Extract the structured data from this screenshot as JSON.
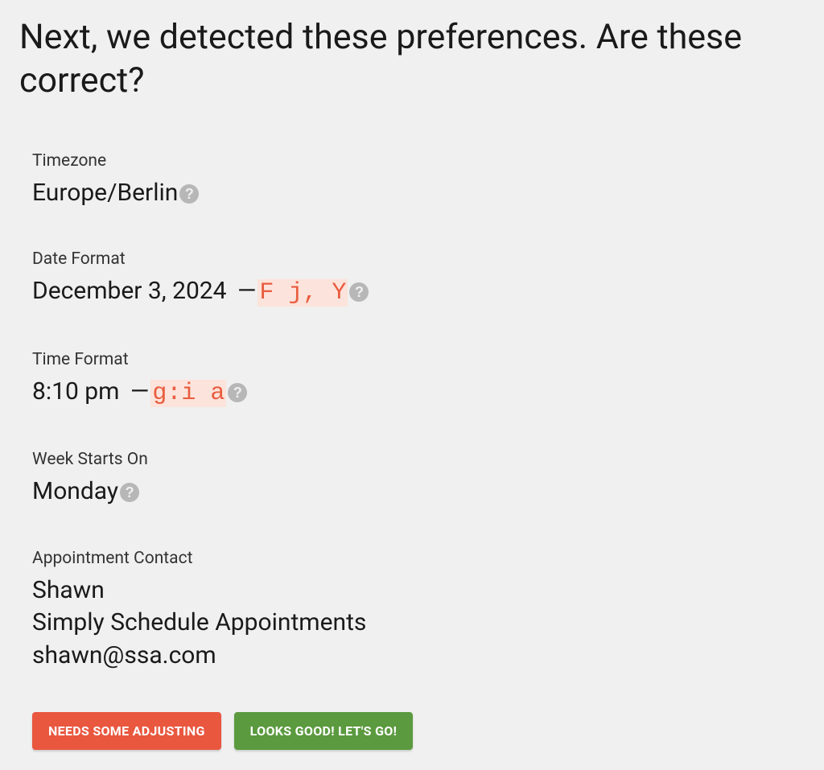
{
  "heading": "Next, we detected these preferences. Are these correct?",
  "prefs": {
    "timezone": {
      "label": "Timezone",
      "value": "Europe/Berlin"
    },
    "date_format": {
      "label": "Date Format",
      "example": "December 3, 2024",
      "code": "F j, Y"
    },
    "time_format": {
      "label": "Time Format",
      "example": "8:10 pm",
      "code": "g:i a"
    },
    "week_starts": {
      "label": "Week Starts On",
      "value": "Monday"
    },
    "contact": {
      "label": "Appointment Contact",
      "name": "Shawn",
      "org": "Simply Schedule Appointments",
      "email": "shawn@ssa.com"
    }
  },
  "buttons": {
    "adjust": "Needs Some Adjusting",
    "confirm": "Looks Good! Let's Go!"
  }
}
